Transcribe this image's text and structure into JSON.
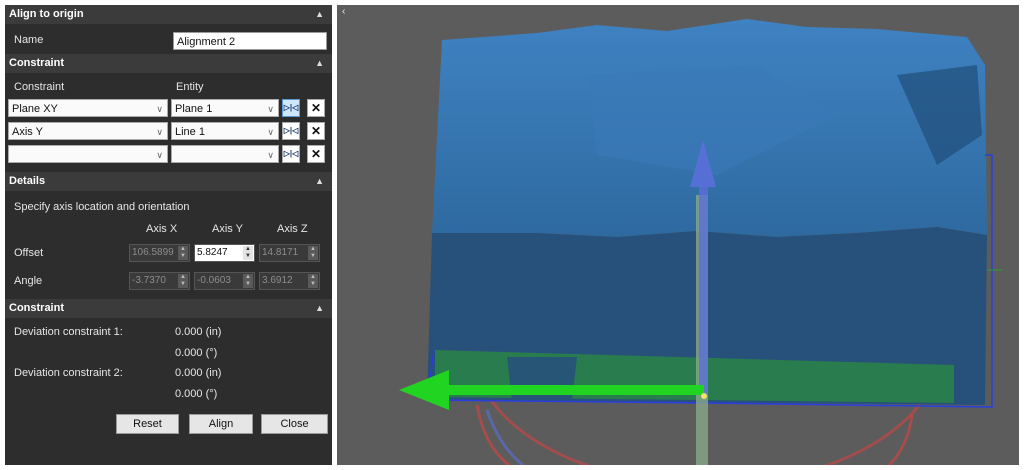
{
  "panel": {
    "title": "Align to origin",
    "name_label": "Name",
    "name_value": "Alignment 2",
    "constraint_section": "Constraint",
    "col_constraint": "Constraint",
    "col_entity": "Entity",
    "rows": [
      {
        "constraint": "Plane XY",
        "entity": "Plane 1"
      },
      {
        "constraint": "Axis Y",
        "entity": "Line 1"
      },
      {
        "constraint": "",
        "entity": ""
      }
    ],
    "details_section": "Details",
    "details_hint": "Specify axis location and orientation",
    "axis_x": "Axis X",
    "axis_y": "Axis Y",
    "axis_z": "Axis Z",
    "offset_label": "Offset",
    "angle_label": "Angle",
    "offset": {
      "x": "106.5899",
      "y": "5.8247",
      "z": "14.8171"
    },
    "angle": {
      "x": "-3.7370",
      "y": "-0.0603",
      "z": "3.6912"
    },
    "constraint2_section": "Constraint",
    "dev1_label": "Deviation constraint 1:",
    "dev1_in": "0.000 (in)",
    "dev1_deg": "0.000 (°)",
    "dev2_label": "Deviation constraint 2:",
    "dev2_in": "0.000 (in)",
    "dev2_deg": "0.000 (°)",
    "reset": "Reset",
    "align": "Align",
    "close": "Close"
  },
  "colors": {
    "panel_bg": "#2d2d2d",
    "header_bg": "#3b3b3b",
    "viewport_bg": "#5c5c5c",
    "mesh_blue": "#2e6aa0",
    "arrow_green": "#22d422",
    "arrow_blue": "#5a6fd8",
    "ring_red": "#b84848"
  }
}
